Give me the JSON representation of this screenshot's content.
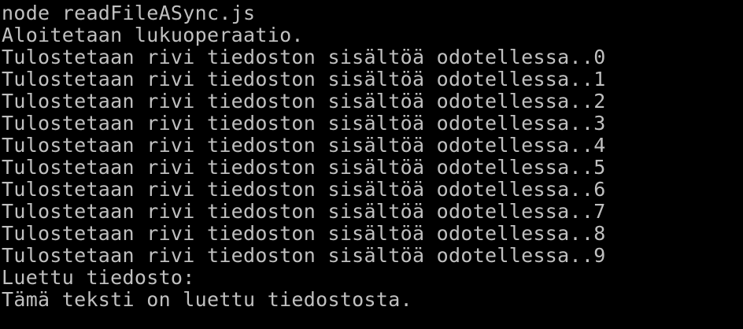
{
  "terminal": {
    "background": "#000000",
    "foreground": "#c0c0c0",
    "lines": [
      "node readFileASync.js",
      "Aloitetaan lukuoperaatio.",
      "Tulostetaan rivi tiedoston sisältöä odotellessa..0",
      "Tulostetaan rivi tiedoston sisältöä odotellessa..1",
      "Tulostetaan rivi tiedoston sisältöä odotellessa..2",
      "Tulostetaan rivi tiedoston sisältöä odotellessa..3",
      "Tulostetaan rivi tiedoston sisältöä odotellessa..4",
      "Tulostetaan rivi tiedoston sisältöä odotellessa..5",
      "Tulostetaan rivi tiedoston sisältöä odotellessa..6",
      "Tulostetaan rivi tiedoston sisältöä odotellessa..7",
      "Tulostetaan rivi tiedoston sisältöä odotellessa..8",
      "Tulostetaan rivi tiedoston sisältöä odotellessa..9",
      "Luettu tiedosto:",
      "Tämä teksti on luettu tiedostosta."
    ]
  }
}
